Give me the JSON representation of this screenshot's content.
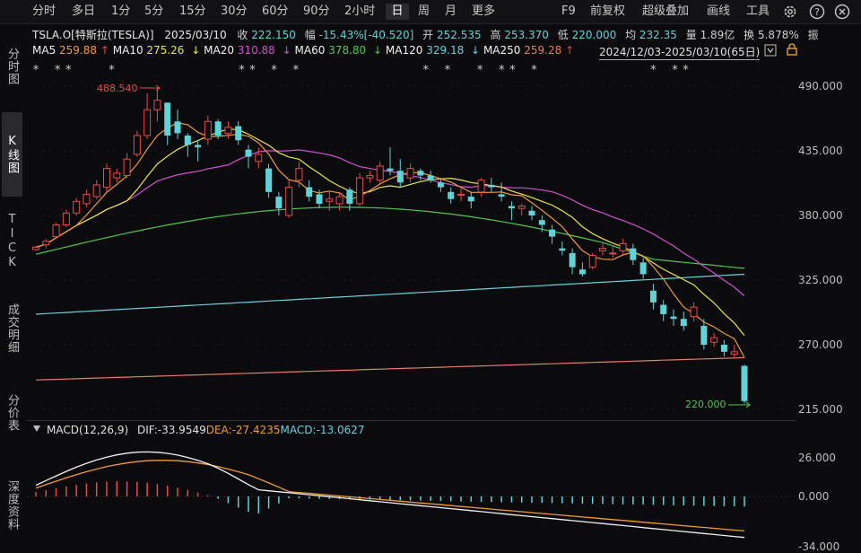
{
  "toolbar": {
    "periods": [
      "分时",
      "多日",
      "1分",
      "5分",
      "15分",
      "30分",
      "60分",
      "90分",
      "2小时",
      "日",
      "周",
      "月",
      "更多"
    ],
    "active_period": "日",
    "tools": [
      "F9",
      "前复权",
      "超级叠加",
      "画线",
      "工具"
    ],
    "icons": [
      "gear-icon",
      "question-icon",
      "close-icon"
    ]
  },
  "sidebar": {
    "items": [
      "分时图",
      "K线图",
      "TICK",
      "成交明细",
      "分价表",
      "深度资料"
    ],
    "active": "K线图"
  },
  "quote": {
    "symbol": "TSLA.O[特斯拉(TESLA)]",
    "date": "2025/03/10",
    "close_label": "收",
    "close": "222.150",
    "change_label": "幅",
    "change": "-15.43%[-40.520]",
    "open_label": "开",
    "open": "252.535",
    "high_label": "高",
    "high": "253.370",
    "low_label": "低",
    "low": "220.000",
    "avg_label": "均",
    "avg": "232.35",
    "volume_label": "量",
    "volume": "1.89亿",
    "turnover_label": "换",
    "turnover": "5.878%",
    "amplitude_label": "振"
  },
  "ma_legend": [
    {
      "label": "MA5",
      "value": "259.88",
      "arrow": "↑",
      "color": "#f2f2f2"
    },
    {
      "label": "MA10",
      "value": "275.26",
      "arrow": "↓",
      "color": "#f29a3a"
    },
    {
      "label": "MA20",
      "value": "310.88",
      "arrow": "↓",
      "color": "#e6e64a"
    },
    {
      "label": "MA60",
      "value": "378.80",
      "arrow": "↓",
      "color": "#d050d0"
    },
    {
      "label": "MA120",
      "value": "329.18",
      "arrow": "↓",
      "color": "#4fc84f"
    },
    {
      "label": "MA250",
      "value": "259.28",
      "arrow": "↑",
      "color": "#6ad0e0"
    }
  ],
  "range": "2024/12/03-2025/03/10(65日)",
  "price_axis": [
    "490.000",
    "435.000",
    "380.000",
    "325.000",
    "270.000",
    "215.000"
  ],
  "annotations": {
    "high_mark": "488.540",
    "low_mark": "220.000"
  },
  "macd": {
    "title": "MACD(12,26,9)",
    "dif_label": "DIF:",
    "dif": "-33.9549",
    "dea_label": "DEA:",
    "dea": "-27.4235",
    "macd_label": "MACD:",
    "macd": "-13.0627",
    "axis": [
      "26.000",
      "0.000",
      "-34.000"
    ]
  },
  "colors": {
    "up": "#e84a4a",
    "down": "#5fd3d8",
    "dif": "#f0f0f0",
    "dea": "#f29a3a"
  },
  "chart_data": {
    "type": "candlestick",
    "ylim": [
      215,
      490
    ],
    "candles": [
      [
        351,
        353,
        354,
        350
      ],
      [
        355,
        358,
        360,
        352
      ],
      [
        362,
        372,
        374,
        360
      ],
      [
        372,
        382,
        385,
        370
      ],
      [
        382,
        392,
        395,
        380
      ],
      [
        390,
        398,
        402,
        387
      ],
      [
        396,
        406,
        410,
        394
      ],
      [
        404,
        420,
        424,
        400
      ],
      [
        412,
        416,
        420,
        408
      ],
      [
        414,
        428,
        433,
        412
      ],
      [
        432,
        448,
        452,
        430
      ],
      [
        448,
        470,
        484,
        445
      ],
      [
        470,
        478,
        488.54,
        460
      ],
      [
        476,
        448,
        472,
        440
      ],
      [
        460,
        450,
        470,
        445
      ],
      [
        448,
        440,
        450,
        430
      ],
      [
        440,
        438,
        444,
        426
      ],
      [
        445,
        460,
        465,
        440
      ],
      [
        460,
        448,
        462,
        445
      ],
      [
        450,
        455,
        460,
        445
      ],
      [
        456,
        444,
        460,
        440
      ],
      [
        436,
        430,
        440,
        420
      ],
      [
        426,
        432,
        438,
        420
      ],
      [
        420,
        400,
        424,
        395
      ],
      [
        396,
        386,
        400,
        380
      ],
      [
        380,
        404,
        410,
        378
      ],
      [
        410,
        420,
        426,
        404
      ],
      [
        404,
        396,
        410,
        392
      ],
      [
        398,
        390,
        402,
        386
      ],
      [
        392,
        394,
        400,
        384
      ],
      [
        390,
        396,
        400,
        384
      ],
      [
        402,
        390,
        404,
        384
      ],
      [
        390,
        412,
        416,
        388
      ],
      [
        412,
        414,
        418,
        408
      ],
      [
        410,
        422,
        426,
        406
      ],
      [
        420,
        418,
        438,
        414
      ],
      [
        418,
        408,
        428,
        404
      ],
      [
        412,
        420,
        424,
        408
      ],
      [
        418,
        414,
        420,
        410
      ],
      [
        414,
        410,
        418,
        408
      ],
      [
        408,
        404,
        412,
        400
      ],
      [
        400,
        394,
        404,
        390
      ],
      [
        398,
        398,
        403,
        392
      ],
      [
        396,
        392,
        400,
        386
      ],
      [
        400,
        410,
        412,
        396
      ],
      [
        406,
        404,
        412,
        400
      ],
      [
        398,
        396,
        408,
        392
      ],
      [
        388,
        386,
        392,
        376
      ],
      [
        386,
        388,
        390,
        380
      ],
      [
        384,
        380,
        388,
        376
      ],
      [
        376,
        372,
        380,
        366
      ],
      [
        368,
        362,
        372,
        356
      ],
      [
        352,
        350,
        358,
        346
      ],
      [
        348,
        336,
        352,
        330
      ],
      [
        334,
        330,
        340,
        328
      ],
      [
        336,
        346,
        348,
        334
      ],
      [
        350,
        352,
        356,
        346
      ],
      [
        348,
        348,
        354,
        344
      ],
      [
        350,
        356,
        360,
        346
      ],
      [
        352,
        342,
        356,
        338
      ],
      [
        340,
        330,
        344,
        326
      ],
      [
        316,
        306,
        322,
        300
      ],
      [
        304,
        296,
        308,
        290
      ],
      [
        294,
        292,
        300,
        286
      ],
      [
        292,
        286,
        298,
        282
      ],
      [
        294,
        302,
        306,
        290
      ],
      [
        286,
        270,
        292,
        266
      ],
      [
        272,
        276,
        280,
        268
      ],
      [
        270,
        264,
        274,
        260
      ],
      [
        262,
        264,
        270,
        258
      ],
      [
        252,
        222,
        253,
        220
      ]
    ]
  }
}
